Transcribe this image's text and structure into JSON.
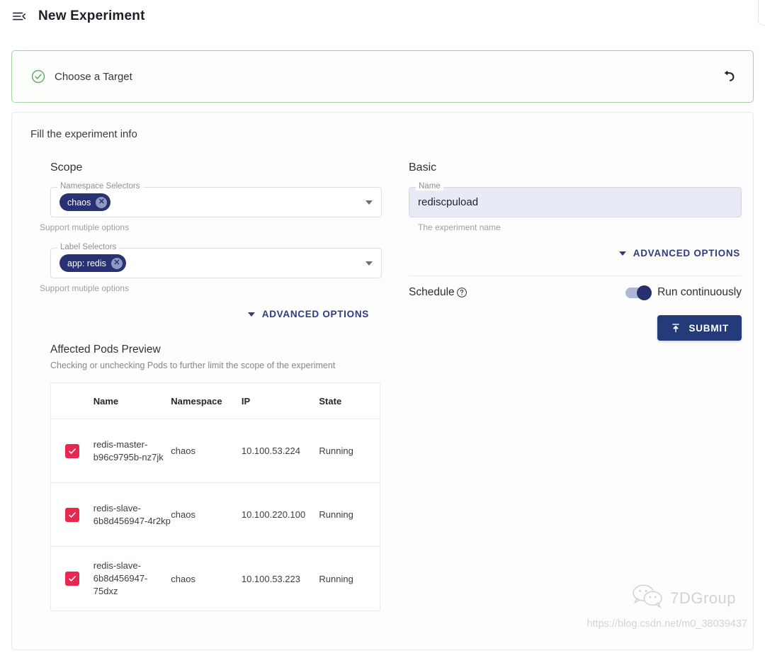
{
  "header": {
    "menu_icon": "menu-collapse-icon",
    "title": "New Experiment"
  },
  "step": {
    "status_icon": "check-circle-icon",
    "label": "Choose a Target",
    "undo_icon": "undo-arrow-icon",
    "border_color": "#a8cfa4",
    "icon_color": "#5fa85c"
  },
  "form": {
    "heading": "Fill the experiment info",
    "scope": {
      "title": "Scope",
      "namespace_selectors": {
        "legend": "Namespace Selectors",
        "chips": [
          "chaos"
        ],
        "helper": "Support mutiple options"
      },
      "label_selectors": {
        "legend": "Label Selectors",
        "chips": [
          "app: redis"
        ],
        "helper": "Support mutiple options"
      },
      "advanced_label": "ADVANCED OPTIONS"
    },
    "basic": {
      "title": "Basic",
      "name_field": {
        "legend": "Name",
        "value": "rediscpuload",
        "placeholder": "Name",
        "helper": "The experiment name"
      },
      "advanced_label": "ADVANCED OPTIONS",
      "schedule": {
        "label": "Schedule",
        "help_icon": "question-circle-icon",
        "toggle_on": true,
        "toggle_label": "Run continuously"
      },
      "submit": {
        "label": "SUBMIT",
        "icon": "publish-icon",
        "color": "#243b7a"
      }
    },
    "pods_preview": {
      "title": "Affected Pods Preview",
      "subtitle": "Checking or unchecking Pods to further limit the scope of the experiment",
      "columns": [
        "",
        "Name",
        "Namespace",
        "IP",
        "State"
      ],
      "checkbox_color": "#e7274f",
      "rows": [
        {
          "checked": true,
          "name": "redis-master-b96c9795b-nz7jk",
          "namespace": "chaos",
          "ip": "10.100.53.224",
          "state": "Running"
        },
        {
          "checked": true,
          "name": "redis-slave-6b8d456947-4r2kp",
          "namespace": "chaos",
          "ip": "10.100.220.100",
          "state": "Running"
        },
        {
          "checked": true,
          "name": "redis-slave-6b8d456947-75dxz",
          "namespace": "chaos",
          "ip": "10.100.53.223",
          "state": "Running"
        }
      ]
    }
  },
  "watermark": {
    "icon": "wechat-icon",
    "text": "7DGroup",
    "url": "https://blog.csdn.net/m0_38039437"
  },
  "theme": {
    "chip_bg": "#283272",
    "accent_navy": "#2f3b82",
    "autofill_bg": "#e8eaf6"
  }
}
